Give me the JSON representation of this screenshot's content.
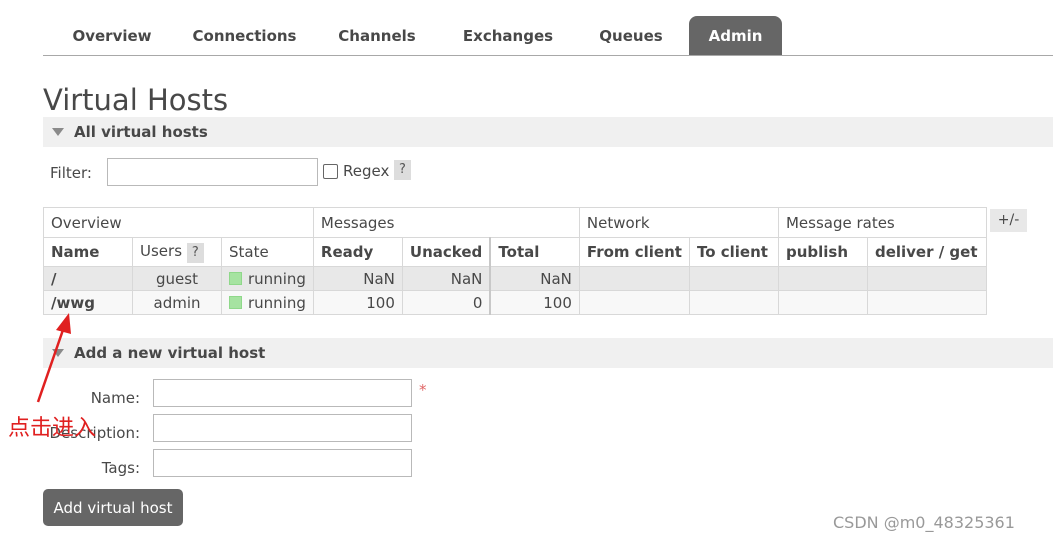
{
  "tabs": [
    {
      "label": "Overview"
    },
    {
      "label": "Connections"
    },
    {
      "label": "Channels"
    },
    {
      "label": "Exchanges"
    },
    {
      "label": "Queues"
    },
    {
      "label": "Admin"
    }
  ],
  "active_tab": "Admin",
  "page_title": "Virtual Hosts",
  "all_vhosts": {
    "header": "All virtual hosts",
    "filter_label": "Filter:",
    "filter_value": "",
    "regex_label": "Regex",
    "help": "?",
    "plusminus": "+/-"
  },
  "table": {
    "groups": [
      "Overview",
      "Messages",
      "Network",
      "Message rates"
    ],
    "columns": [
      "Name",
      "Users",
      "State",
      "Ready",
      "Unacked",
      "Total",
      "From client",
      "To client",
      "publish",
      "deliver / get"
    ],
    "rows": [
      {
        "name": "/",
        "users": "guest",
        "state": "running",
        "ready": "NaN",
        "unacked": "NaN",
        "total": "NaN",
        "from_client": "",
        "to_client": "",
        "publish": "",
        "deliver_get": ""
      },
      {
        "name": "/wwg",
        "users": "admin",
        "state": "running",
        "ready": "100",
        "unacked": "0",
        "total": "100",
        "from_client": "",
        "to_client": "",
        "publish": "",
        "deliver_get": ""
      }
    ]
  },
  "add_vhost": {
    "header": "Add a new virtual host",
    "name_label": "Name:",
    "description_label": "Description:",
    "tags_label": "Tags:",
    "required_mark": "*",
    "button": "Add virtual host"
  },
  "annotation": {
    "text": "点击进入"
  },
  "watermark": "CSDN @m0_48325361",
  "colors": {
    "tab_active": "#666666",
    "running": "#a6e3a1",
    "annotation": "#e02020",
    "required": "#e06666"
  }
}
